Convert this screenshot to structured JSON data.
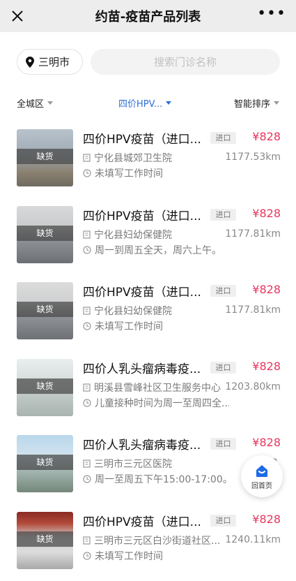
{
  "header": {
    "title": "约苗-疫苗产品列表"
  },
  "location": {
    "city": "三明市"
  },
  "search": {
    "placeholder": "搜索门诊名称"
  },
  "filters": [
    {
      "label": "全城区",
      "active": false
    },
    {
      "label": "四价HPV...",
      "active": true
    },
    {
      "label": "智能排序",
      "active": false
    }
  ],
  "items": [
    {
      "name": "四价HPV疫苗（进口...",
      "tag": "进口",
      "price": "¥828",
      "stock": "缺货",
      "clinic": "宁化县城郊卫生院",
      "distance": "1177.53km",
      "hours": "未填写工作时间"
    },
    {
      "name": "四价HPV疫苗（进口...",
      "tag": "进口",
      "price": "¥828",
      "stock": "缺货",
      "clinic": "宁化县妇幼保健院",
      "distance": "1177.81km",
      "hours": "周一到周五全天，周六上午。"
    },
    {
      "name": "四价HPV疫苗（进口...",
      "tag": "进口",
      "price": "¥828",
      "stock": "缺货",
      "clinic": "宁化县妇幼保健院",
      "distance": "1177.81km",
      "hours": "未填写工作时间"
    },
    {
      "name": "四价人乳头瘤病毒疫...",
      "tag": "进口",
      "price": "¥828",
      "stock": "缺货",
      "clinic": "明溪县雪峰社区卫生服务中心",
      "distance": "1203.80km",
      "hours": "儿童接种时间为周一至周四全..."
    },
    {
      "name": "四价人乳头瘤病毒疫...",
      "tag": "进口",
      "price": "¥828",
      "stock": "缺货",
      "clinic": "三明市三元区医院",
      "distance": "1238.",
      "hours": "周一至周五下午15:00-17:00。"
    },
    {
      "name": "四价HPV疫苗（进口...",
      "tag": "进口",
      "price": "¥828",
      "stock": "缺货",
      "clinic": "三明市三元区白沙街道社区...",
      "distance": "1240.11km",
      "hours": "未填写工作时间"
    }
  ],
  "home_button": {
    "label": "回首页"
  },
  "colors": {
    "price": "#e8365d",
    "active_filter": "#2f6fd6",
    "home_icon": "#1e6be6"
  }
}
